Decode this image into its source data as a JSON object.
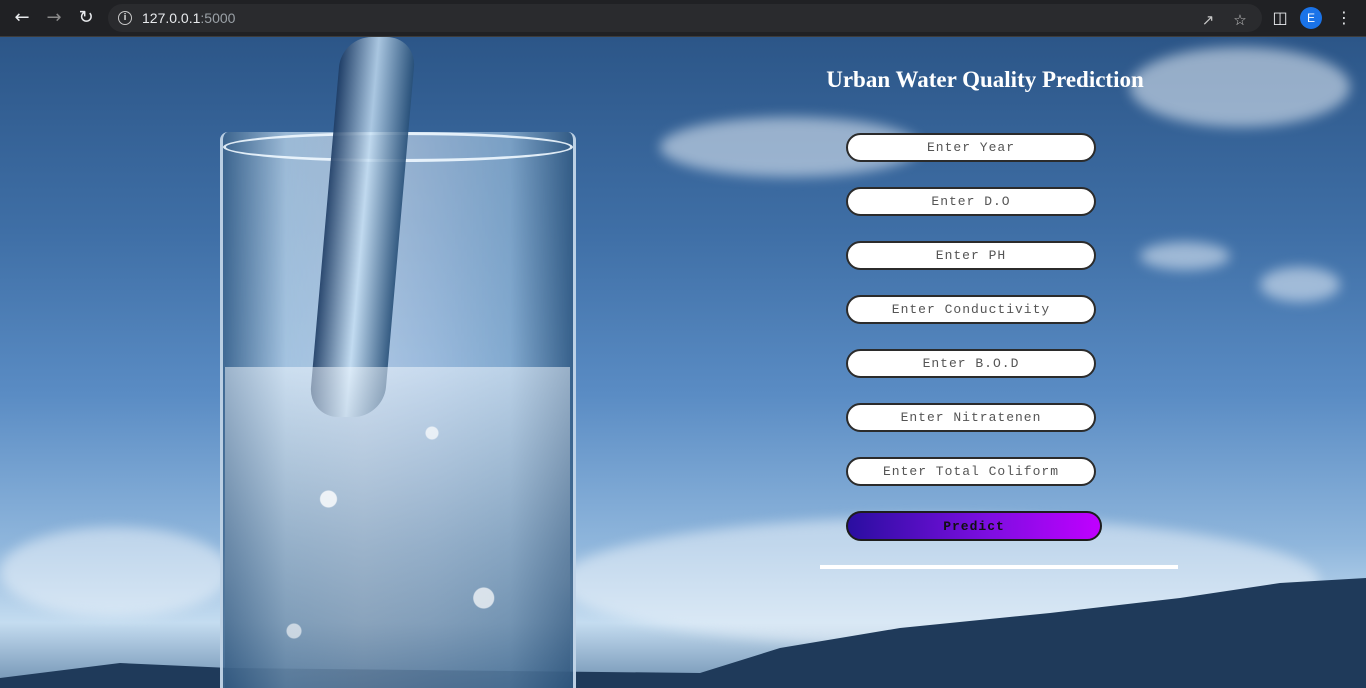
{
  "browser": {
    "url_host": "127.0.0.1",
    "url_port": ":5000",
    "avatar_letter": "E"
  },
  "main": {
    "title": "Urban Water Quality Prediction",
    "fields": [
      {
        "name": "year",
        "placeholder": "Enter Year"
      },
      {
        "name": "do",
        "placeholder": "Enter D.O"
      },
      {
        "name": "ph",
        "placeholder": "Enter PH"
      },
      {
        "name": "conductivity",
        "placeholder": "Enter Conductivity"
      },
      {
        "name": "bod",
        "placeholder": "Enter B.O.D"
      },
      {
        "name": "nitratenen",
        "placeholder": "Enter Nitratenen"
      },
      {
        "name": "total-coliform",
        "placeholder": "Enter Total Coliform"
      }
    ],
    "predict_label": "Predict"
  },
  "colors": {
    "browser_bg": "#202124",
    "button_gradient_start": "#2a0ea0",
    "button_gradient_end": "#c000ff"
  }
}
